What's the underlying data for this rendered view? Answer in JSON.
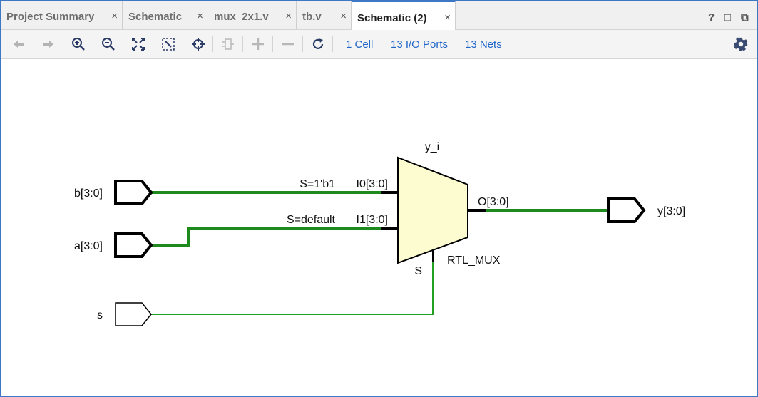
{
  "tabs": [
    {
      "label": "Project Summary",
      "active": false
    },
    {
      "label": "Schematic",
      "active": false
    },
    {
      "label": "mux_2x1.v",
      "active": false
    },
    {
      "label": "tb.v",
      "active": false
    },
    {
      "label": "Schematic (2)",
      "active": true
    }
  ],
  "tab_close_glyph": "×",
  "window_controls": {
    "help": "?",
    "restore": "□",
    "float": "⧉"
  },
  "toolbar": {
    "cells_link": "1 Cell",
    "io_ports_link": "13 I/O Ports",
    "nets_link": "13 Nets",
    "icons": [
      "back-arrow-icon",
      "forward-arrow-icon",
      "zoom-in-icon",
      "zoom-out-icon",
      "zoom-fit-icon",
      "zoom-area-icon",
      "crosshair-icon",
      "cell-icon",
      "plus-icon",
      "minus-icon",
      "refresh-icon",
      "gear-icon"
    ]
  },
  "schematic": {
    "inputs": [
      {
        "name": "b[3:0]",
        "bus": true
      },
      {
        "name": "a[3:0]",
        "bus": true
      },
      {
        "name": "s",
        "bus": false
      }
    ],
    "output": {
      "name": "y[3:0]",
      "bus": true
    },
    "cell": {
      "instance": "y_i",
      "type": "RTL_MUX",
      "pin_i0": "I0[3:0]",
      "pin_i1": "I1[3:0]",
      "pin_o": "O[3:0]",
      "pin_s": "S",
      "cond_i0": "S=1'b1",
      "cond_i1": "S=default"
    },
    "colors": {
      "net": "#1e8a1e",
      "cell_fill": "#fdfcd0",
      "port": "#000000"
    }
  }
}
